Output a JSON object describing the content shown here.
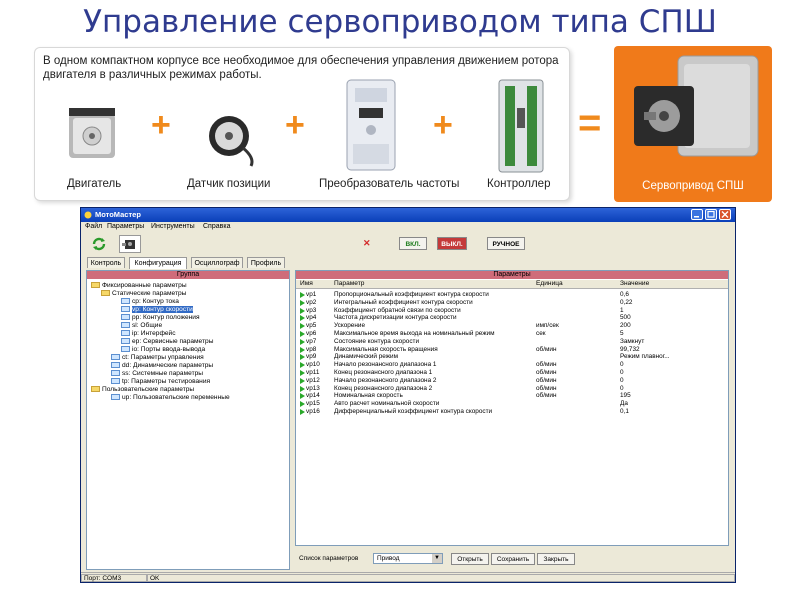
{
  "slide": {
    "title": "Управление сервоприводом типа СПШ"
  },
  "banner": {
    "description": "В одном компактном корпусе все необходимое для обеспечения управления движением ротора двигателя в различных режимах работы.",
    "components": [
      {
        "label": "Двигатель"
      },
      {
        "label": "Датчик позиции"
      },
      {
        "label": "Преобразователь частоты"
      },
      {
        "label": "Контроллер"
      }
    ],
    "plus": "+",
    "equals": "=",
    "result_label": "Сервопривод СПШ"
  },
  "window": {
    "title": "МотоМастер",
    "menu": [
      "Файл",
      "Параметры",
      "Инструменты",
      "Справка"
    ],
    "toolbar": {
      "close_mark": "✕",
      "on": "ВКЛ.",
      "off": "ВЫКЛ.",
      "manual": "РУЧНОЕ"
    },
    "tabs": [
      "Контроль",
      "Конфигурация",
      "Осциллограф",
      "Профиль"
    ],
    "tree": {
      "header": "Группа",
      "nodes": [
        "Фиксированные параметры",
        "Статические параметры",
        "cp: Контур тока",
        "vp: Контур скорости",
        "pp: Контур положения",
        "sl: Общие",
        "ip: Интерфейс",
        "ep: Сервисные параметры",
        "io: Порты ввода-вывода",
        "ct: Параметры управления",
        "dd: Динамические параметры",
        "ss: Системные параметры",
        "tp: Параметры тестирования",
        "Пользовательские параметры",
        "up: Пользовательские переменные"
      ]
    },
    "params": {
      "header": "Параметры",
      "columns": [
        "Имя",
        "Параметр",
        "Единица",
        "Значение"
      ],
      "rows": [
        [
          "vp1",
          "Пропорциональный коэффициент контура скорости",
          "",
          "0,6"
        ],
        [
          "vp2",
          "Интегральный коэффициент контура скорости",
          "",
          "0,22"
        ],
        [
          "vp3",
          "Коэффициент обратной связи по скорости",
          "",
          "1"
        ],
        [
          "vp4",
          "Частота дискретизации контура скорости",
          "",
          "500"
        ],
        [
          "vp5",
          "Ускорение",
          "имп/сек",
          "200"
        ],
        [
          "vp6",
          "Максимальное время выхода на номинальный режим",
          "сек",
          "5"
        ],
        [
          "vp7",
          "Состояние контура скорости",
          "",
          "Замкнут"
        ],
        [
          "vp8",
          "Максимальная скорость вращения",
          "об/мин",
          "99,732"
        ],
        [
          "vp9",
          "Динамический режим",
          "",
          "Режим плавног..."
        ],
        [
          "vp10",
          "Начало резонансного диапазона 1",
          "об/мин",
          "0"
        ],
        [
          "vp11",
          "Конец резонансного диапазона 1",
          "об/мин",
          "0"
        ],
        [
          "vp12",
          "Начало резонансного диапазона 2",
          "об/мин",
          "0"
        ],
        [
          "vp13",
          "Конец резонансного диапазона 2",
          "об/мин",
          "0"
        ],
        [
          "vp14",
          "Номинальная скорость",
          "об/мин",
          "195"
        ],
        [
          "vp15",
          "Авто расчет номинальной скорости",
          "",
          "Да"
        ],
        [
          "vp16",
          "Дифференциальный коэффициент контура скорости",
          "",
          "0,1"
        ]
      ]
    },
    "bottom": {
      "list_label": "Список параметров",
      "list_value": "Привод",
      "open": "Открыть",
      "save": "Сохранить",
      "close": "Закрыть"
    },
    "status": {
      "port": "Порт: COM3",
      "state": "OK"
    }
  }
}
